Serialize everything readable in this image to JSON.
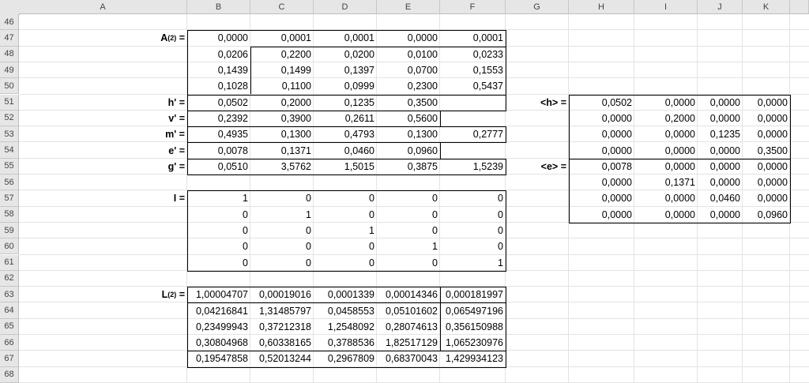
{
  "columns": [
    "A",
    "B",
    "C",
    "D",
    "E",
    "F",
    "G",
    "H",
    "I",
    "J",
    "K"
  ],
  "rows": [
    "46",
    "47",
    "48",
    "49",
    "50",
    "51",
    "52",
    "53",
    "54",
    "55",
    "56",
    "57",
    "58",
    "59",
    "60",
    "61",
    "62",
    "63",
    "64",
    "65",
    "66",
    "67",
    "68"
  ],
  "labels": {
    "A2": "A",
    "A2_sup": "(2)",
    "A2_eq": " =",
    "h": "h' =",
    "v": "v' =",
    "m": "m' =",
    "e": "e' =",
    "g": "g' =",
    "I": "I =",
    "L2": "L",
    "L2_sup": "(2)",
    "L2_eq": " =",
    "hmat": "<h> =",
    "emat": "<e> ="
  },
  "A2": [
    [
      "0,0000",
      "0,0001",
      "0,0001",
      "0,0000",
      "0,0001"
    ],
    [
      "0,0206",
      "0,2200",
      "0,0200",
      "0,0100",
      "0,0233"
    ],
    [
      "0,1439",
      "0,1499",
      "0,1397",
      "0,0700",
      "0,1553"
    ],
    [
      "0,1028",
      "0,1100",
      "0,0999",
      "0,2300",
      "0,5437"
    ]
  ],
  "vectors": {
    "h": [
      "0,0502",
      "0,2000",
      "0,1235",
      "0,3500",
      ""
    ],
    "v": [
      "0,2392",
      "0,3900",
      "0,2611",
      "0,5600",
      ""
    ],
    "m": [
      "0,4935",
      "0,1300",
      "0,4793",
      "0,1300",
      "0,2777"
    ],
    "e": [
      "0,0078",
      "0,1371",
      "0,0460",
      "0,0960",
      ""
    ],
    "g": [
      "0,0510",
      "3,5762",
      "1,5015",
      "0,3875",
      "1,5239"
    ]
  },
  "I": [
    [
      "1",
      "0",
      "0",
      "0",
      "0"
    ],
    [
      "0",
      "1",
      "0",
      "0",
      "0"
    ],
    [
      "0",
      "0",
      "1",
      "0",
      "0"
    ],
    [
      "0",
      "0",
      "0",
      "1",
      "0"
    ],
    [
      "0",
      "0",
      "0",
      "0",
      "1"
    ]
  ],
  "L2": [
    [
      "1,00004707",
      "0,00019016",
      "0,0001339",
      "0,00014346",
      "0,000181997"
    ],
    [
      "0,04216841",
      "1,31485797",
      "0,0458553",
      "0,05101602",
      "0,065497196"
    ],
    [
      "0,23499943",
      "0,37212318",
      "1,2548092",
      "0,28074613",
      "0,356150988"
    ],
    [
      "0,30804968",
      "0,60338165",
      "0,3788536",
      "1,82517129",
      "1,065230976"
    ],
    [
      "0,19547858",
      "0,52013244",
      "0,2967809",
      "0,68370043",
      "1,429934123"
    ]
  ],
  "Hmat": [
    [
      "0,0502",
      "0,0000",
      "0,0000",
      "0,0000"
    ],
    [
      "0,0000",
      "0,2000",
      "0,0000",
      "0,0000"
    ],
    [
      "0,0000",
      "0,0000",
      "0,1235",
      "0,0000"
    ],
    [
      "0,0000",
      "0,0000",
      "0,0000",
      "0,3500"
    ]
  ],
  "Emat": [
    [
      "0,0078",
      "0,0000",
      "0,0000",
      "0,0000"
    ],
    [
      "0,0000",
      "0,1371",
      "0,0000",
      "0,0000"
    ],
    [
      "0,0000",
      "0,0000",
      "0,0460",
      "0,0000"
    ],
    [
      "0,0000",
      "0,0000",
      "0,0000",
      "0,0960"
    ]
  ]
}
